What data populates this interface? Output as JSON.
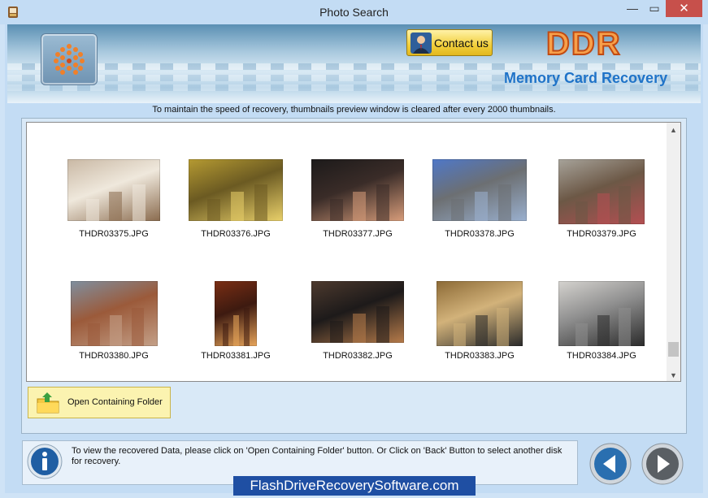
{
  "window": {
    "title": "Photo Search",
    "minimize_glyph": "—",
    "maximize_glyph": "▭",
    "close_glyph": "✕"
  },
  "header": {
    "contact_label": "Contact us",
    "brand": "DDR",
    "product": "Memory Card Recovery"
  },
  "notice": "To maintain the speed of recovery, thumbnails preview window is cleared after every 2000 thumbnails.",
  "thumbnails": [
    {
      "name": "THDR03375.JPG",
      "colors": [
        "#c9b8a4",
        "#8a6b4e",
        "#efe8dc"
      ]
    },
    {
      "name": "THDR03376.JPG",
      "colors": [
        "#b59a32",
        "#e9d06a",
        "#6b5a22"
      ]
    },
    {
      "name": "THDR03377.JPG",
      "colors": [
        "#1c1a1a",
        "#d79c7a",
        "#3a2c28"
      ]
    },
    {
      "name": "THDR03378.JPG",
      "colors": [
        "#4f78c8",
        "#9ab0cf",
        "#6c6f72"
      ]
    },
    {
      "name": "THDR03379.JPG",
      "colors": [
        "#a7a39a",
        "#b44f52",
        "#6c5846"
      ]
    },
    {
      "name": "THDR03380.JPG",
      "colors": [
        "#7f8f9f",
        "#c4a088",
        "#9b5a3a"
      ]
    },
    {
      "name": "THDR03381.JPG",
      "colors": [
        "#7a2e14",
        "#e8a55a",
        "#3d1a10"
      ]
    },
    {
      "name": "THDR03382.JPG",
      "colors": [
        "#4d3a2e",
        "#b67b4a",
        "#1d1a1a"
      ]
    },
    {
      "name": "THDR03383.JPG",
      "colors": [
        "#8c6a36",
        "#2a2a2a",
        "#d2b27a"
      ]
    },
    {
      "name": "THDR03384.JPG",
      "colors": [
        "#d5d3cf",
        "#2b2b2b",
        "#8e8e8e"
      ]
    }
  ],
  "open_folder_label": "Open Containing Folder",
  "bottom_text": "To view the recovered Data, please click on 'Open Containing Folder' button. Or Click on 'Back' Button to select another disk for recovery.",
  "watermark": "FlashDriveRecoverySoftware.com",
  "colors": {
    "accent_blue": "#1f73c8",
    "brand_orange": "#f7a04a",
    "watermark_bg": "#1f4fa3"
  }
}
